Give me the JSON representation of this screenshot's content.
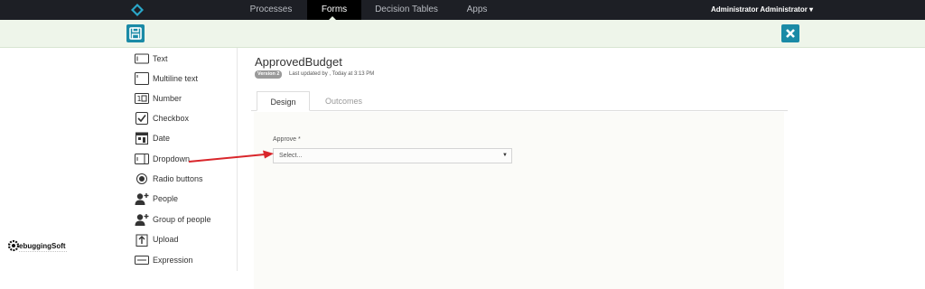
{
  "nav": {
    "items": [
      "Processes",
      "Forms",
      "Decision Tables",
      "Apps"
    ],
    "active": "Forms",
    "user": "Administrator Administrator ▾"
  },
  "toolbar": {
    "save_icon": "floppy-disk-icon",
    "close_icon": "close-x-icon",
    "accent": "#1a8aa6"
  },
  "palette": {
    "items": [
      {
        "label": "Text",
        "icon": "text-field-icon"
      },
      {
        "label": "Multiline text",
        "icon": "multiline-text-icon"
      },
      {
        "label": "Number",
        "icon": "number-icon"
      },
      {
        "label": "Checkbox",
        "icon": "checkbox-icon"
      },
      {
        "label": "Date",
        "icon": "calendar-icon"
      },
      {
        "label": "Dropdown",
        "icon": "dropdown-icon"
      },
      {
        "label": "Radio buttons",
        "icon": "radio-icon"
      },
      {
        "label": "People",
        "icon": "person-add-icon"
      },
      {
        "label": "Group of people",
        "icon": "group-add-icon"
      },
      {
        "label": "Upload",
        "icon": "upload-icon"
      },
      {
        "label": "Expression",
        "icon": "expression-icon"
      }
    ]
  },
  "form": {
    "title": "ApprovedBudget",
    "version": "Version 2",
    "updated": "Last updated by , Today at 3:13 PM",
    "tabs": [
      "Design",
      "Outcomes"
    ],
    "active_tab": "Design",
    "field_label": "Approve *",
    "select_placeholder": "Select..."
  },
  "annotation": {
    "arrow_color": "#d9262b"
  },
  "watermark": {
    "brand": "DebuggingSoft",
    "tagline": "debugging & technology"
  }
}
